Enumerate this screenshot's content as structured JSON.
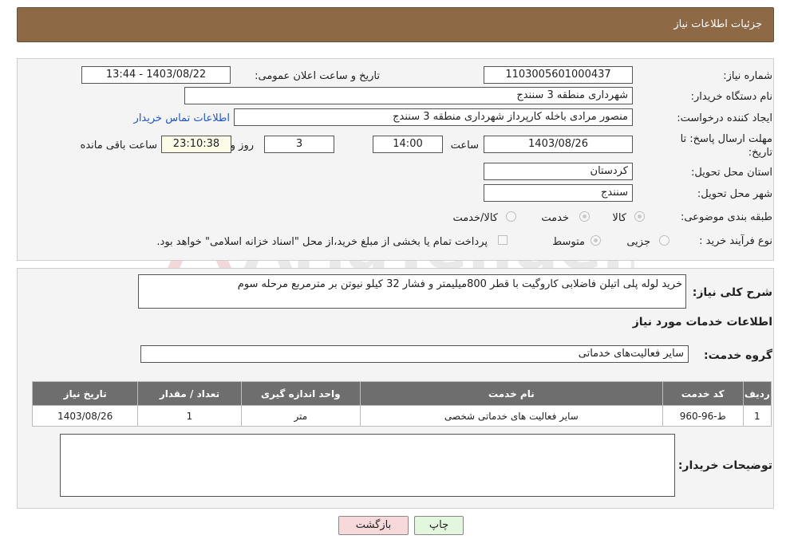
{
  "header": {
    "title": "جزئیات اطلاعات نیاز"
  },
  "form": {
    "need_number_label": "شماره نیاز:",
    "need_number": "1103005601000437",
    "announce_label": "تاریخ و ساعت اعلان عمومی:",
    "announce_value": "1403/08/22 - 13:44",
    "buyer_org_label": "نام دستگاه خریدار:",
    "buyer_org": "شهرداری منطقه 3 سنندج",
    "creator_label": "ایجاد کننده درخواست:",
    "creator": "منصور مرادی باخله کارپرداز شهرداری منطقه 3 سنندج",
    "contact_link": "اطلاعات تماس خریدار",
    "deadline_label_1": "مهلت ارسال پاسخ: تا",
    "deadline_label_2": "تاریخ:",
    "deadline_date": "1403/08/26",
    "hour_label": "ساعت",
    "deadline_time": "14:00",
    "days": "3",
    "days_label": "روز و",
    "remaining": "23:10:38",
    "remaining_label": "ساعت باقی مانده",
    "province_label": "استان محل تحویل:",
    "province": "کردستان",
    "city_label": "شهر محل تحویل:",
    "city": "سنندج",
    "category_label": "طبقه بندی موضوعی:",
    "category_options": [
      "کالا",
      "خدمت",
      "کالا/خدمت"
    ],
    "purchase_type_label": "نوع فرآیند خرید :",
    "purchase_options": [
      "جزیی",
      "متوسط"
    ],
    "payment_note": "پرداخت تمام یا بخشی از مبلغ خرید،از محل \"اسناد خزانه اسلامی\" خواهد بود."
  },
  "description": {
    "label": "شرح کلی نیاز:",
    "text": "خرید لوله پلی اتیلن فاضلابی کاروگیت با قطر 800میلیمتر و فشار 32 کیلو نیوتن بر مترمربع مرحله سوم"
  },
  "services": {
    "section_title": "اطلاعات خدمات مورد نیاز",
    "group_label": "گروه خدمت:",
    "group_value": "سایر فعالیت‌های خدماتی",
    "columns": [
      "ردیف",
      "کد خدمت",
      "نام خدمت",
      "واحد اندازه گیری",
      "تعداد / مقدار",
      "تاریخ نیاز"
    ],
    "rows": [
      [
        "1",
        "ط-96-960",
        "سایر فعالیت های خدماتی شخصی",
        "متر",
        "1",
        "1403/08/26"
      ]
    ]
  },
  "buyer_notes": {
    "label": "توضیحات خریدار:",
    "text": ""
  },
  "buttons": {
    "print": "چاپ",
    "back": "بازگشت"
  },
  "colors": {
    "header_bg": "#8d6a45",
    "table_header_bg": "#6e6e6e",
    "back_button_bg": "#f7d9d9",
    "print_button_bg": "#e3f7df"
  }
}
